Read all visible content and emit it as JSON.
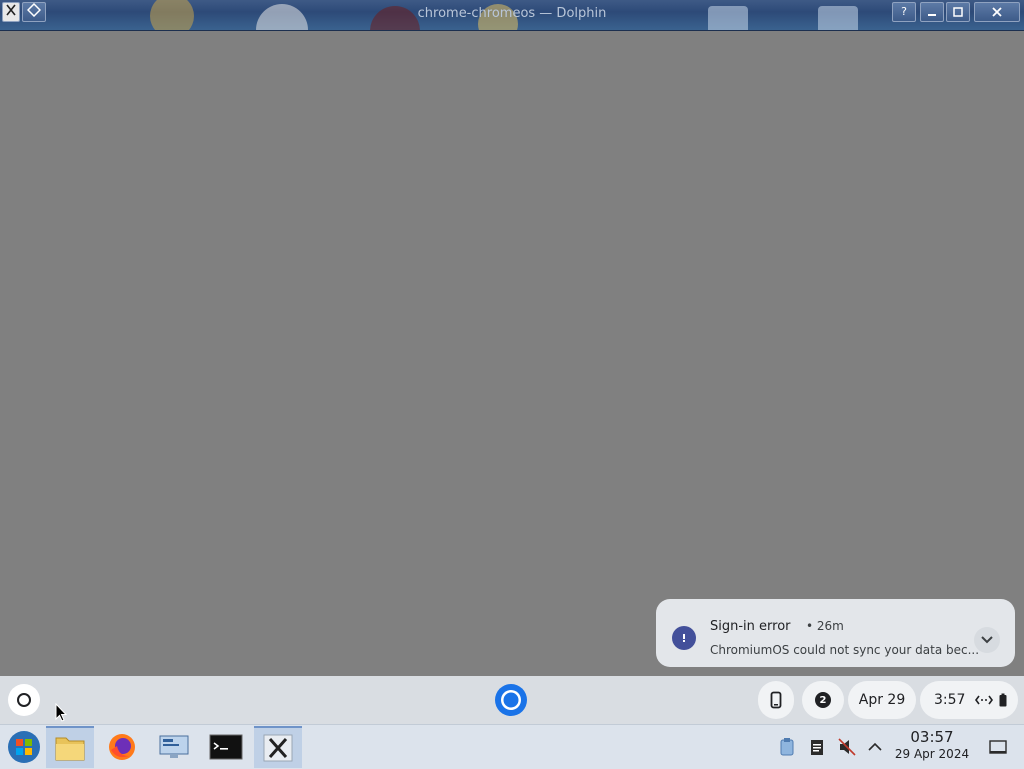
{
  "titlebar": {
    "title": "chrome-chromeos — Dolphin",
    "help_label": "?"
  },
  "shelf": {
    "launcher_icon": "launcher-circle-icon",
    "app_icon": "chromium-icon",
    "phone_icon": "phone-hub-icon",
    "notification_count": "2",
    "date": "Apr 29",
    "time": "3:57",
    "network_icon": "ethernet-icon",
    "battery_icon": "battery-icon"
  },
  "notification": {
    "title": "Sign-in error",
    "time": "26m",
    "body": "ChromiumOS could not sync your data bec...",
    "icon": "alert-icon"
  },
  "taskbar": {
    "apps": [
      {
        "name": "start-menu-icon"
      },
      {
        "name": "file-manager-icon"
      },
      {
        "name": "firefox-icon"
      },
      {
        "name": "remote-desktop-icon"
      },
      {
        "name": "terminal-icon"
      },
      {
        "name": "x-window-icon"
      }
    ],
    "tray": {
      "clock_time": "03:57",
      "clock_date": "29 Apr 2024"
    }
  },
  "colors": {
    "desktop": "#808080",
    "shelf": "#d9dde2",
    "notification_accent": "#43509a"
  }
}
